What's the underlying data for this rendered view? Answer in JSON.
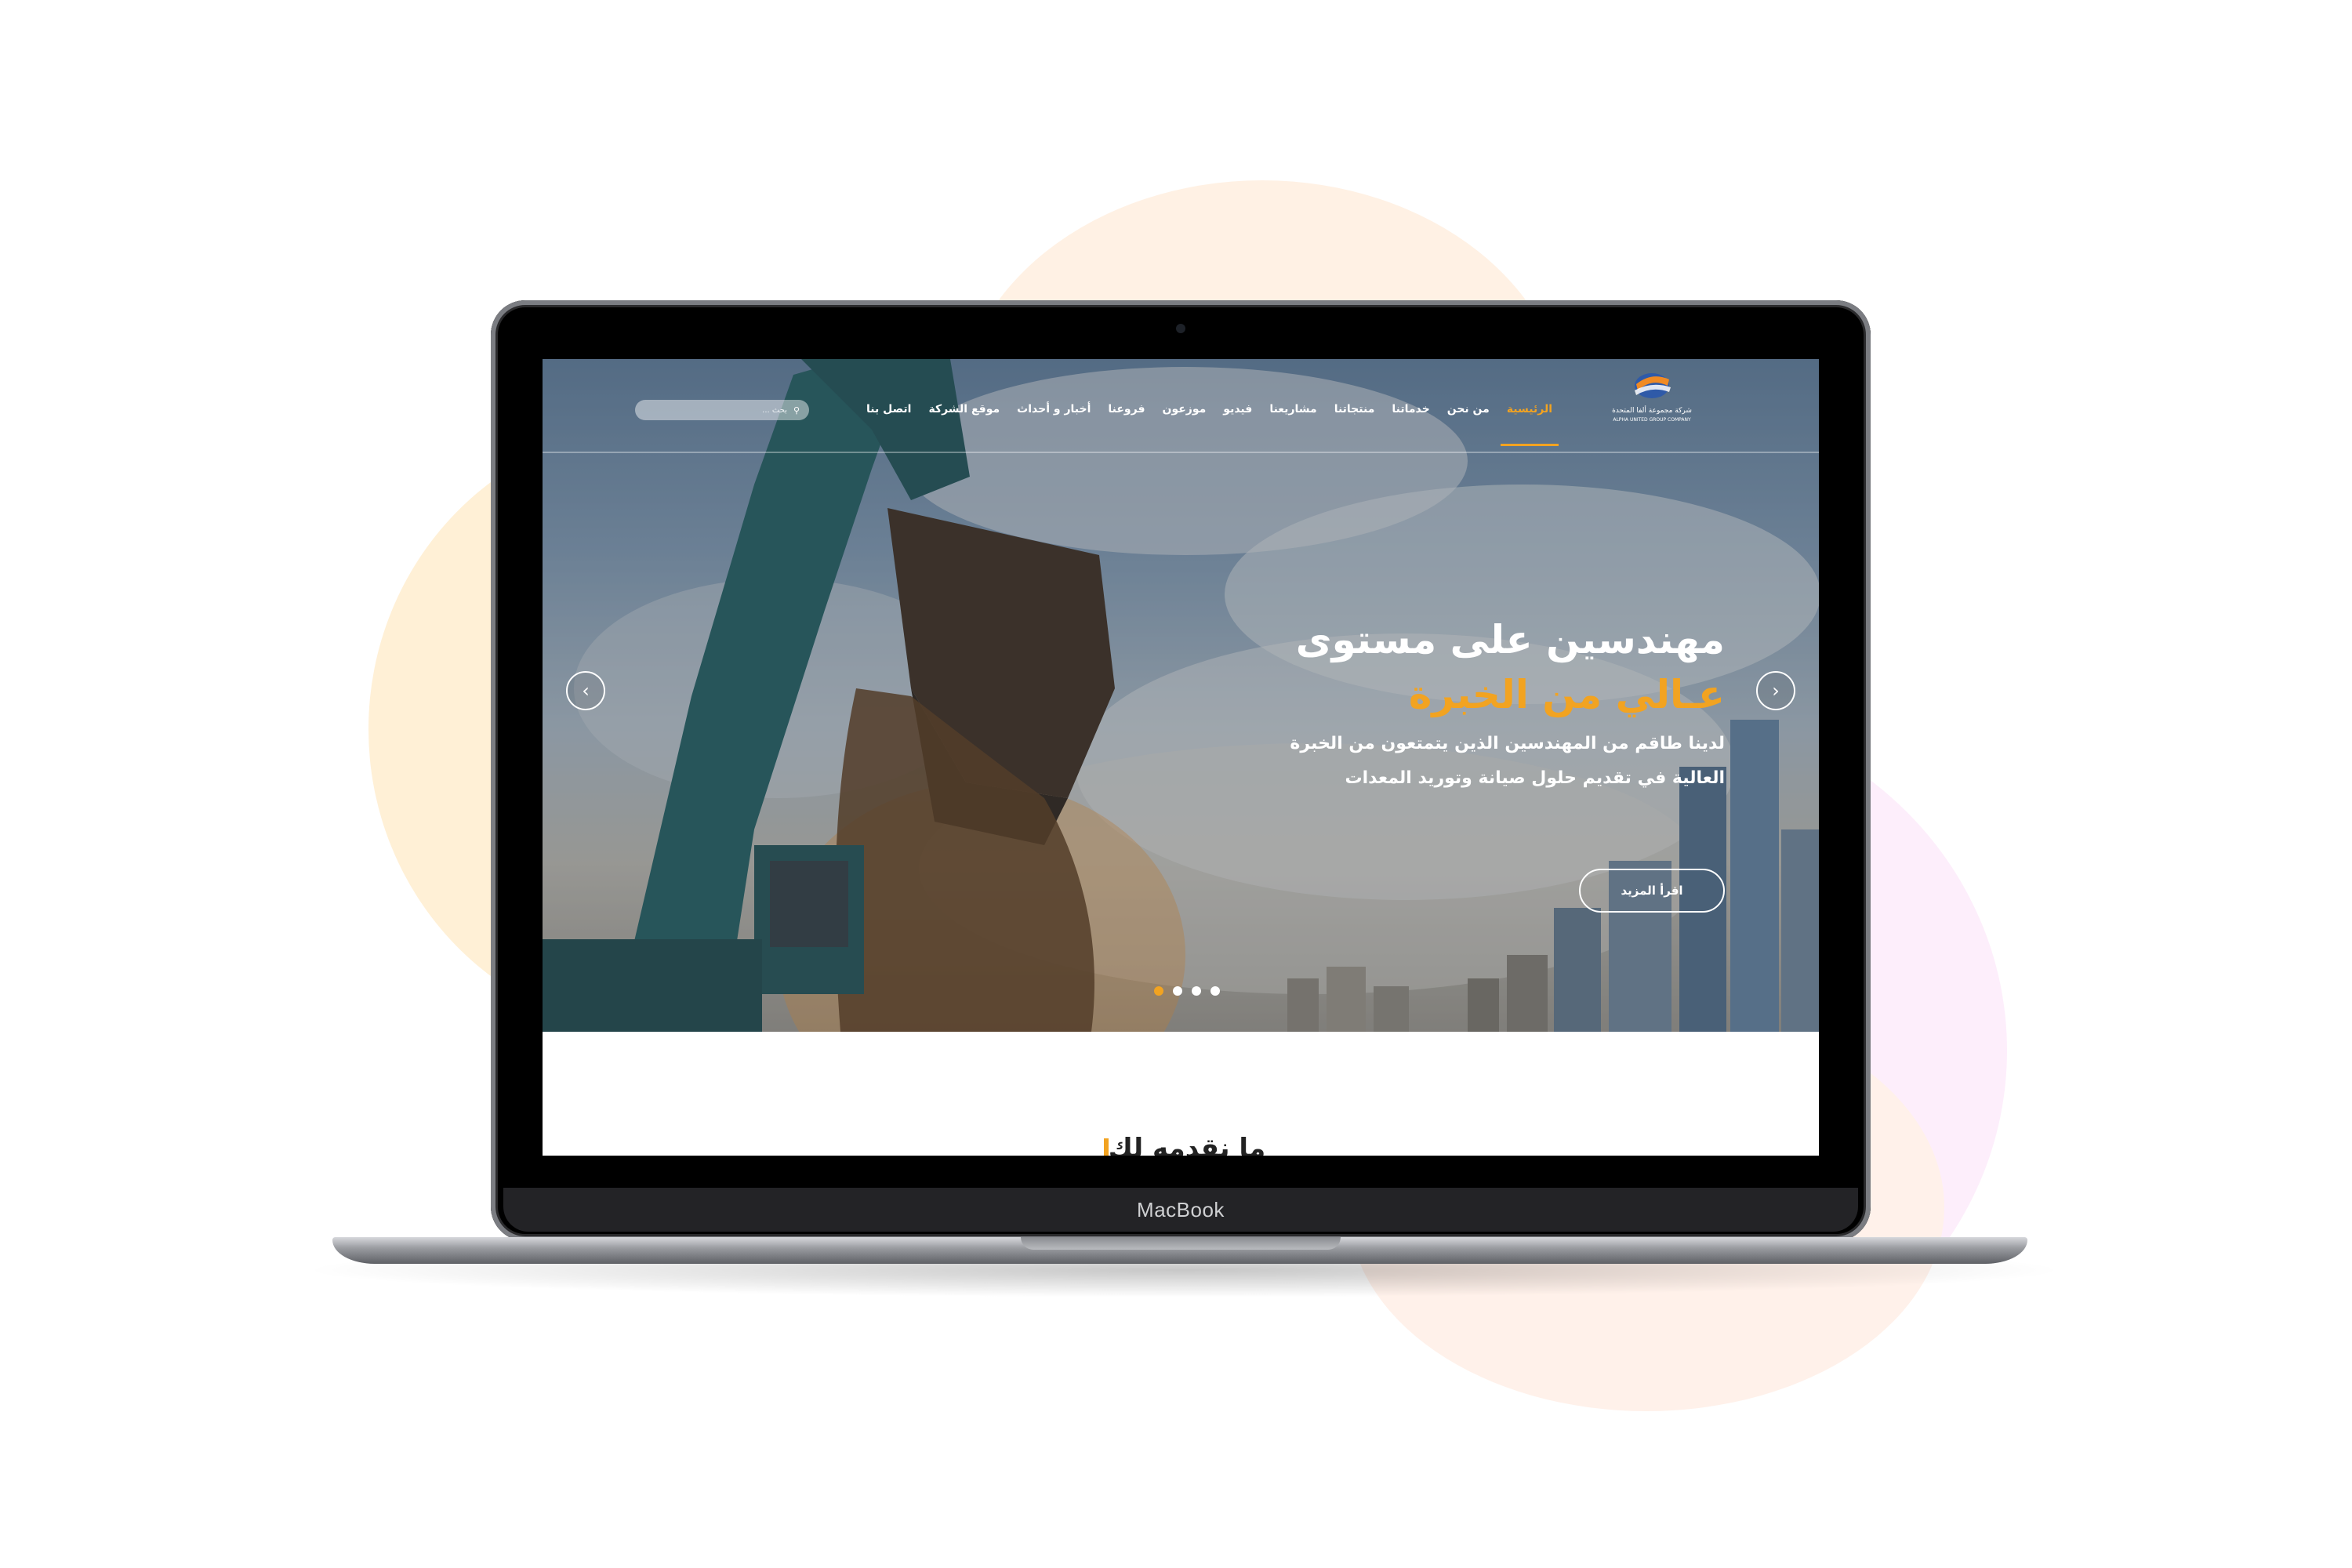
{
  "device": {
    "label": "MacBook"
  },
  "site": {
    "logo_text": "شركة مجموعة ألفا المتحدة",
    "logo_subtext": "ALPHA UNITED GROUP COMPANY",
    "nav": {
      "items": [
        {
          "label": "الرئيسية",
          "active": true
        },
        {
          "label": "من نحن"
        },
        {
          "label": "خدماتنا"
        },
        {
          "label": "منتجاتنا"
        },
        {
          "label": "مشاريعنا"
        },
        {
          "label": "فيديو"
        },
        {
          "label": "موزعون"
        },
        {
          "label": "فروعنا"
        },
        {
          "label": "أخبار و أحداث"
        },
        {
          "label": "موقع الشركة"
        },
        {
          "label": "اتصل بنا"
        }
      ]
    },
    "search": {
      "placeholder": "بحث ..."
    },
    "hero": {
      "headline_line1": "مهندسين على مستوى",
      "headline_line2": "عـالي من الخبرة",
      "description_line1": "لدينا طاقم من المهندسين الذين يتمتعون من الخبرة",
      "description_line2": "العالية في تقديم حلول صيانة وتوريد المعدات",
      "button_label": "اقرأ المزيد",
      "slide_count": 4,
      "active_slide": 1
    },
    "next_section_heading": "ما نقدمه لك",
    "colors": {
      "accent": "#f2a321",
      "hero_text": "#ffffff"
    }
  }
}
